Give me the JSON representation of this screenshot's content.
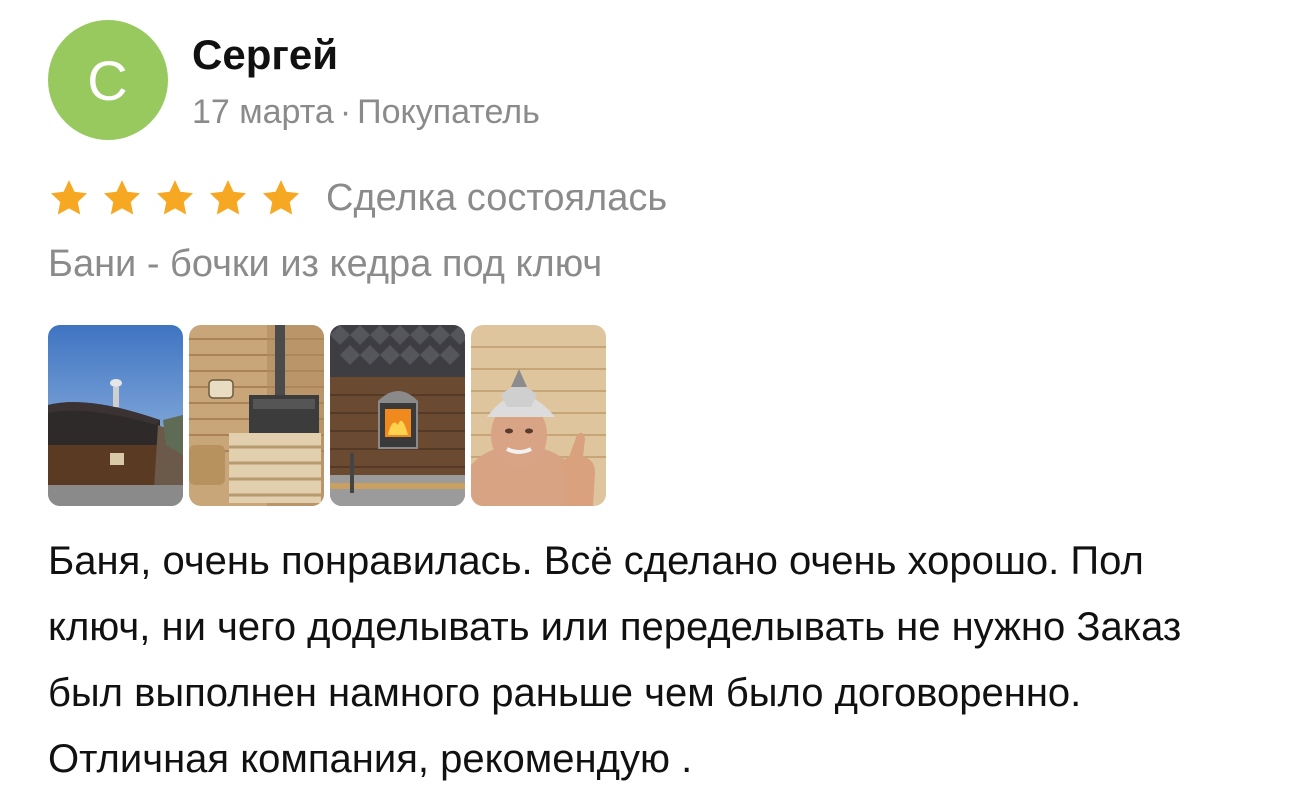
{
  "author": {
    "avatar_letter": "С",
    "avatar_color": "#97c95e",
    "name": "Сергей",
    "date": "17 марта",
    "separator": "·",
    "role": "Покупатель"
  },
  "rating": {
    "stars": 5,
    "max_stars": 5,
    "star_color": "#f7a823",
    "star_icon": "star-icon",
    "status": "Сделка состоялась"
  },
  "item": {
    "title": "Бани - бочки из кедра под ключ"
  },
  "photos": [
    {
      "subject": "barrel-sauna-exterior"
    },
    {
      "subject": "sauna-stove-interior"
    },
    {
      "subject": "stove-fire-door"
    },
    {
      "subject": "man-in-sauna-hat"
    }
  ],
  "review": {
    "text": "Баня, очень понравилась. Всё сделано очень хорошо. Пол ключ, ни чего доделывать или переделывать не нужно Заказ был выполнен намного раньше чем было договоренно. Отличная компания, рекомендую ."
  }
}
